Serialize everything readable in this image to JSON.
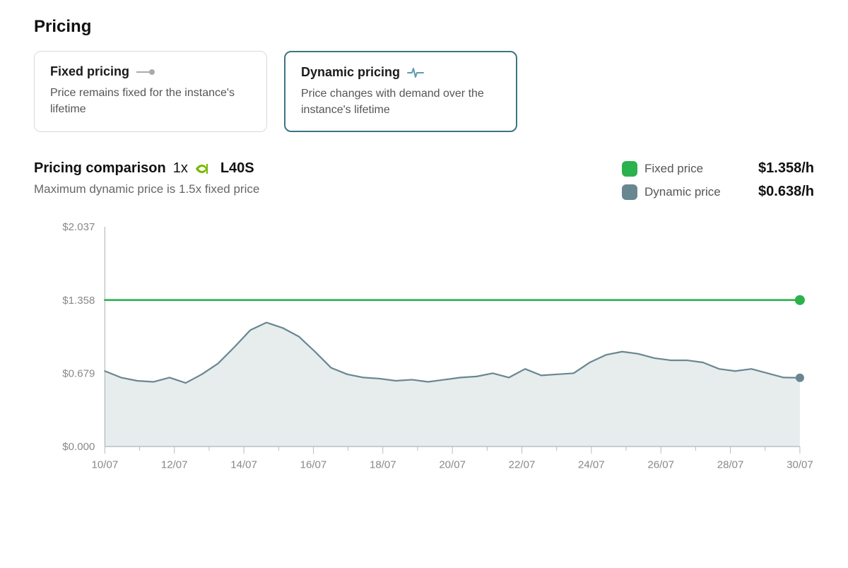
{
  "header": {
    "title": "Pricing"
  },
  "options": {
    "fixed": {
      "title": "Fixed pricing",
      "desc": "Price remains fixed for the instance's lifetime"
    },
    "dynamic": {
      "title": "Dynamic pricing",
      "desc": "Price changes with demand over the instance's lifetime"
    },
    "selected": "dynamic"
  },
  "summary": {
    "title": "Pricing comparison",
    "quantity": "1x",
    "gpu_label": "L40S",
    "note": "Maximum dynamic price is 1.5x fixed price"
  },
  "legend": {
    "fixed": {
      "label": "Fixed price",
      "value": "$1.358/h",
      "color": "#2bb24c"
    },
    "dynamic": {
      "label": "Dynamic price",
      "value": "$0.638/h",
      "color": "#698791"
    }
  },
  "chart_data": {
    "type": "area+line",
    "title": "Pricing comparison",
    "xlabel": "",
    "ylabel": "",
    "ylim": [
      0,
      2.037
    ],
    "y_ticks": [
      0.0,
      0.679,
      1.358,
      2.037
    ],
    "y_tick_labels": [
      "$0.000",
      "$0.679",
      "$1.358",
      "$2.037"
    ],
    "x_tick_labels": [
      "10/07",
      "12/07",
      "14/07",
      "16/07",
      "18/07",
      "20/07",
      "22/07",
      "24/07",
      "26/07",
      "28/07",
      "30/07"
    ],
    "x_tick_dense_count": 21,
    "series": [
      {
        "name": "Fixed price",
        "type": "line",
        "color": "#2bb24c",
        "values": [
          1.358,
          1.358,
          1.358,
          1.358,
          1.358,
          1.358,
          1.358,
          1.358,
          1.358,
          1.358,
          1.358,
          1.358,
          1.358,
          1.358,
          1.358,
          1.358,
          1.358,
          1.358,
          1.358,
          1.358,
          1.358,
          1.358
        ],
        "end_dot": true
      },
      {
        "name": "Dynamic price",
        "type": "area",
        "color": "#698791",
        "fill": "rgba(105,135,145,0.16)",
        "values": [
          0.7,
          0.64,
          0.61,
          0.6,
          0.64,
          0.59,
          0.67,
          0.77,
          0.92,
          1.08,
          1.15,
          1.1,
          1.02,
          0.88,
          0.73,
          0.67,
          0.64,
          0.63,
          0.61,
          0.62,
          0.6,
          0.62,
          0.64,
          0.65,
          0.68,
          0.64,
          0.72,
          0.66,
          0.67,
          0.68,
          0.78,
          0.85,
          0.88,
          0.86,
          0.82,
          0.8,
          0.8,
          0.78,
          0.72,
          0.7,
          0.72,
          0.68,
          0.64,
          0.638
        ],
        "end_dot": true
      }
    ]
  }
}
